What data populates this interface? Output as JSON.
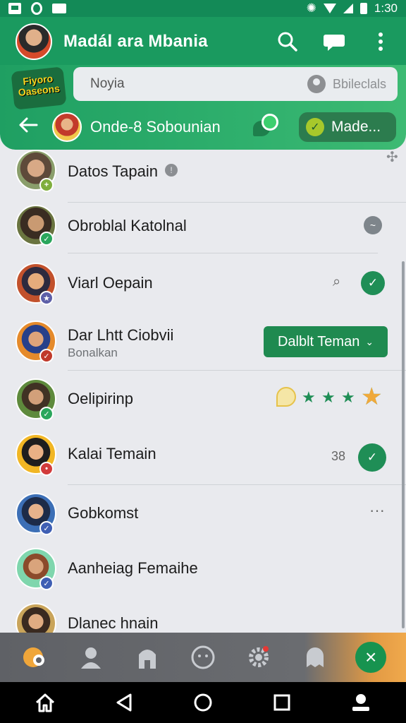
{
  "status_bar": {
    "time": "1:30"
  },
  "header": {
    "title": "Madál ara Mbania"
  },
  "brand": {
    "logo_text": "Fiyoro Oaseons"
  },
  "search": {
    "placeholder": "Noyia",
    "tag_label": "Bbileclals"
  },
  "chat": {
    "name": "Onde-8 Sobounian",
    "made_label": "Made..."
  },
  "contacts": [
    {
      "name": "Datos Tapain"
    },
    {
      "name": "Obroblal Katolnal"
    },
    {
      "name": "Viarl Oepain"
    },
    {
      "name": "Dar Lhtt Ciobvii",
      "subtitle": "Bonalkan",
      "action_label": "Dalblt Teman"
    },
    {
      "name": "Oelipirinp"
    },
    {
      "name": "Kalai Temain",
      "count": "38"
    },
    {
      "name": "Gobkomst"
    },
    {
      "name": "Aanheiag Femaihe"
    },
    {
      "name": "Dlanec hnain"
    }
  ],
  "colors": {
    "primary": "#1a9a5f",
    "accent": "#1f8e56",
    "tabbar_end": "#f0a94c"
  },
  "icons": [
    "search-icon",
    "chat-icon",
    "more-icon",
    "back-icon",
    "home-icon",
    "back-nav-icon",
    "recents-icon",
    "person-icon"
  ]
}
